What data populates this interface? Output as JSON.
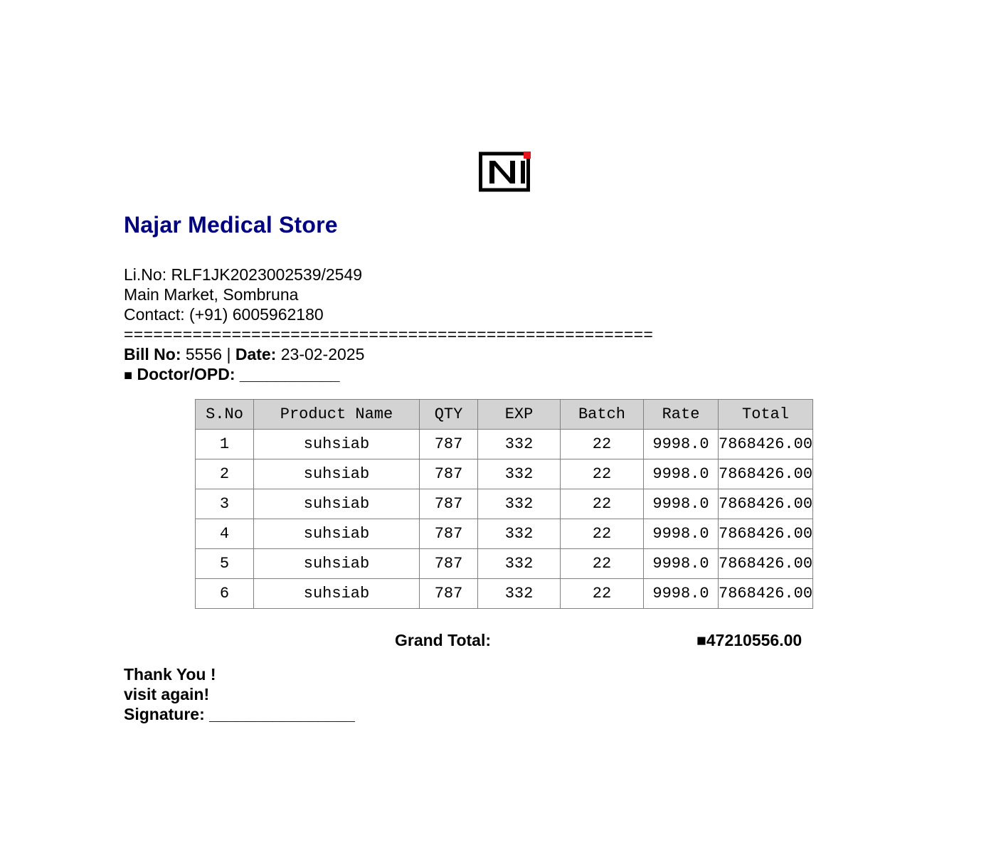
{
  "store": {
    "name": "Najar Medical Store",
    "license_label": "Li.No:",
    "license_number": "RLF1JK2023002539/2549",
    "address": "Main Market, Sombruna",
    "contact_label": "Contact:",
    "contact_number": "(+91) 6005962180",
    "brand_color": "#000080"
  },
  "logo": {
    "letter": "N",
    "accent_color": "#e8141c"
  },
  "separator": "======================================================",
  "bill": {
    "bill_no_label": "Bill No:",
    "bill_no": "5556",
    "divider": "|",
    "date_label": "Date:",
    "date": "23-02-2025",
    "doctor_bullet": "■",
    "doctor_label": "Doctor/OPD:",
    "doctor_blank": "___________"
  },
  "table": {
    "headers": [
      "S.No",
      "Product Name",
      "QTY",
      "EXP",
      "Batch",
      "Rate",
      "Total"
    ],
    "rows": [
      [
        "1",
        "suhsiab",
        "787",
        "332",
        "22",
        "9998.0",
        "7868426.00"
      ],
      [
        "2",
        "suhsiab",
        "787",
        "332",
        "22",
        "9998.0",
        "7868426.00"
      ],
      [
        "3",
        "suhsiab",
        "787",
        "332",
        "22",
        "9998.0",
        "7868426.00"
      ],
      [
        "4",
        "suhsiab",
        "787",
        "332",
        "22",
        "9998.0",
        "7868426.00"
      ],
      [
        "5",
        "suhsiab",
        "787",
        "332",
        "22",
        "9998.0",
        "7868426.00"
      ],
      [
        "6",
        "suhsiab",
        "787",
        "332",
        "22",
        "9998.0",
        "7868426.00"
      ]
    ],
    "header_bg": "#d3d3d3",
    "border_color": "#808080"
  },
  "totals": {
    "grand_label": "Grand Total:",
    "grand_value": "■47210556.00"
  },
  "footer": {
    "thanks": "Thank You !",
    "visit": "visit again!",
    "signature_label": "Signature:",
    "signature_blank": "________________"
  }
}
